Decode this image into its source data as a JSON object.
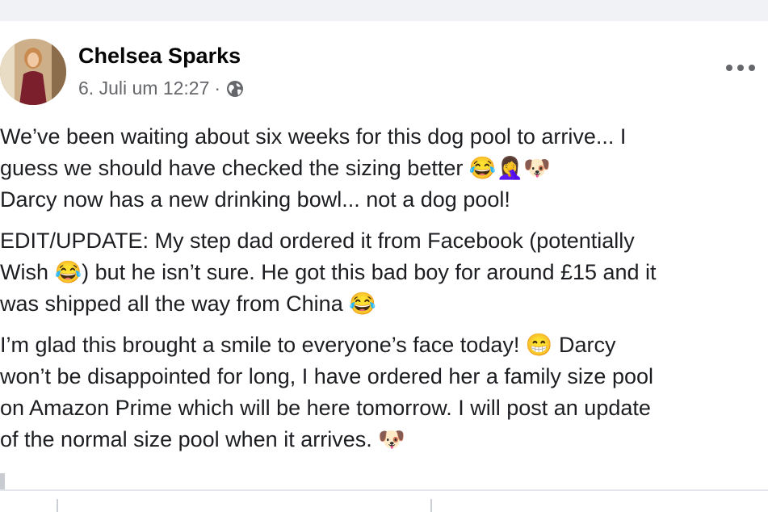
{
  "post": {
    "author_name": "Chelsea Sparks",
    "timestamp": "6. Juli um 12:27",
    "separator": "·",
    "privacy_icon": "globe-icon",
    "more_icon": "more-options-icon",
    "paragraphs": [
      {
        "lines": [
          "We’ve been waiting about six weeks for this dog pool to arrive... I",
          "guess we should have checked the sizing better 😂🤦‍♀️🐶",
          "Darcy now has a new drinking bowl... not a dog pool!"
        ]
      },
      {
        "lines": [
          "EDIT/UPDATE: My step dad ordered it from Facebook (potentially",
          "Wish 😂) but he isn’t sure. He got this bad boy for around £15 and it",
          "was shipped all the way from China 😂"
        ]
      },
      {
        "lines": [
          "I’m glad this brought a smile to everyone’s face today! 😁 Darcy",
          "won’t be disappointed for long, I have ordered her a family size pool",
          "on Amazon Prime which will be here tomorrow. I will post an update",
          "of the normal size pool when it arrives. 🐶"
        ]
      }
    ]
  }
}
